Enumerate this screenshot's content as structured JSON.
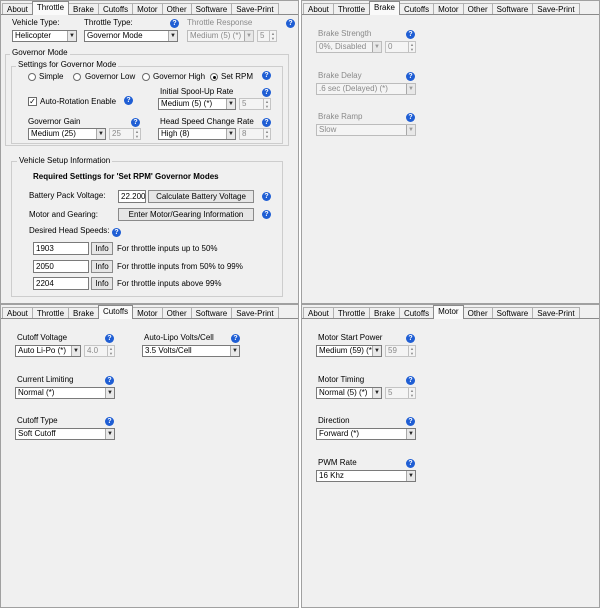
{
  "tabs": [
    "About",
    "Throttle",
    "Brake",
    "Cutoffs",
    "Motor",
    "Other",
    "Software",
    "Save-Print"
  ],
  "throttle": {
    "vehicle_type_label": "Vehicle Type:",
    "vehicle_type_value": "Helicopter",
    "throttle_type_label": "Throttle Type:",
    "throttle_type_value": "Governor Mode",
    "throttle_response_label": "Throttle Response",
    "throttle_response_value": "Medium (5) (*)",
    "throttle_response_num": "5",
    "governor_mode_group": "Governor Mode",
    "settings_group": "Settings for Governor Mode",
    "radio_simple": "Simple",
    "radio_governor_low": "Governor Low",
    "radio_governor_high": "Governor High",
    "radio_set_rpm": "Set RPM",
    "auto_rotation_label": "Auto-Rotation Enable",
    "spool_up_label": "Initial Spool-Up Rate",
    "spool_up_value": "Medium (5) (*)",
    "spool_up_num": "5",
    "governor_gain_label": "Governor Gain",
    "governor_gain_value": "Medium (25)",
    "governor_gain_num": "25",
    "head_speed_change_label": "Head Speed Change Rate",
    "head_speed_change_value": "High (8)",
    "head_speed_change_num": "8",
    "vehicle_setup_group": "Vehicle Setup Information",
    "required_heading": "Required Settings for 'Set RPM' Governor Modes",
    "battery_voltage_label": "Battery Pack Voltage:",
    "battery_voltage_value": "22.200",
    "calc_battery_button": "Calculate Battery Voltage",
    "motor_gearing_label": "Motor and Gearing:",
    "motor_gearing_button": "Enter Motor/Gearing Information",
    "desired_head_speeds_label": "Desired Head Speeds:",
    "head_speeds": [
      {
        "value": "1903",
        "info": "Info",
        "desc": "For throttle inputs up to 50%"
      },
      {
        "value": "2050",
        "info": "Info",
        "desc": "For throttle inputs from 50% to 99%"
      },
      {
        "value": "2204",
        "info": "Info",
        "desc": "For throttle inputs above 99%"
      }
    ]
  },
  "brake": {
    "strength_label": "Brake Strength",
    "strength_value": "0%, Disabled",
    "strength_num": "0",
    "delay_label": "Brake Delay",
    "delay_value": ".6 sec (Delayed) (*)",
    "ramp_label": "Brake Ramp",
    "ramp_value": "Slow"
  },
  "cutoffs": {
    "cutoff_voltage_label": "Cutoff Voltage",
    "cutoff_voltage_value": "Auto Li-Po (*)",
    "cutoff_voltage_num": "4.0",
    "auto_lipo_label": "Auto-Lipo Volts/Cell",
    "auto_lipo_value": "3.5 Volts/Cell",
    "current_limiting_label": "Current Limiting",
    "current_limiting_value": "Normal (*)",
    "cutoff_type_label": "Cutoff Type",
    "cutoff_type_value": "Soft Cutoff"
  },
  "motor": {
    "start_power_label": "Motor Start Power",
    "start_power_value": "Medium (59) (*)",
    "start_power_num": "59",
    "timing_label": "Motor Timing",
    "timing_value": "Normal (5) (*)",
    "timing_num": "5",
    "direction_label": "Direction",
    "direction_value": "Forward (*)",
    "pwm_label": "PWM Rate",
    "pwm_value": "16 Khz"
  },
  "help_glyph": "?",
  "arrow_glyph": "▼",
  "spin_glyph_up": "▲",
  "spin_glyph_down": "▼",
  "check_glyph": "✓"
}
